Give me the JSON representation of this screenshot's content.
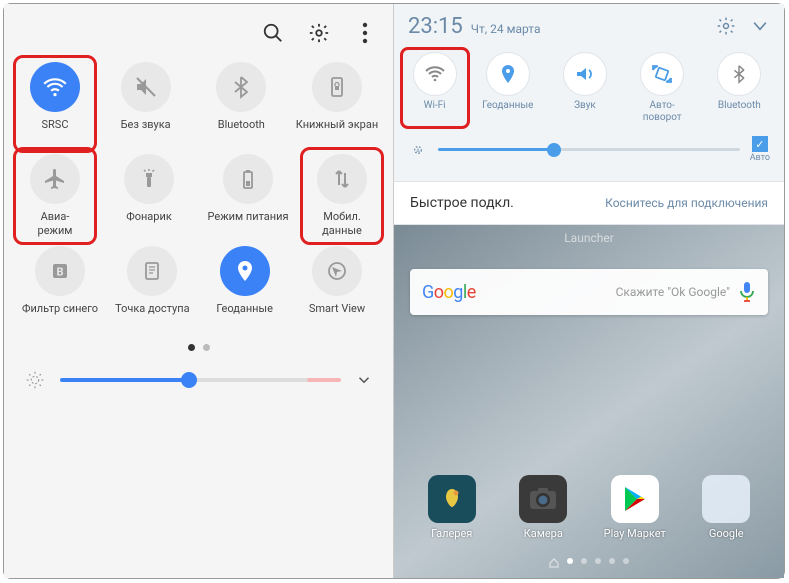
{
  "left_panel": {
    "tiles": [
      {
        "label": "SRSC",
        "active": true,
        "highlight": true,
        "icon": "wifi"
      },
      {
        "label": "Без звука",
        "icon": "mute"
      },
      {
        "label": "Bluetooth",
        "icon": "bluetooth"
      },
      {
        "label": "Книжный экран",
        "icon": "portrait-lock"
      },
      {
        "label": "Авиа-\nрежим",
        "highlight": true,
        "icon": "airplane"
      },
      {
        "label": "Фонарик",
        "icon": "flashlight"
      },
      {
        "label": "Режим питания",
        "icon": "battery"
      },
      {
        "label": "Мобил. данные",
        "highlight": true,
        "icon": "mobile-data"
      },
      {
        "label": "Фильтр синего",
        "icon": "blue-filter"
      },
      {
        "label": "Точка доступа",
        "icon": "hotspot"
      },
      {
        "label": "Геоданные",
        "active": true,
        "icon": "location"
      },
      {
        "label": "Smart View",
        "icon": "smart-view"
      }
    ],
    "brightness": 45
  },
  "right_panel": {
    "time": "23:15",
    "date": "Чт, 24 марта",
    "tiles": [
      {
        "label": "Wi-Fi",
        "highlight": true,
        "icon": "wifi",
        "color": "#888"
      },
      {
        "label": "Геоданные",
        "icon": "location",
        "color": "#4a9de8"
      },
      {
        "label": "Звук",
        "icon": "sound",
        "color": "#4a9de8"
      },
      {
        "label": "Авто-\nповорот",
        "icon": "rotate",
        "color": "#4a9de8"
      },
      {
        "label": "Bluetooth",
        "icon": "bluetooth",
        "color": "#888"
      }
    ],
    "auto_brightness_label": "Авто",
    "brightness": 38,
    "quick_connect_left": "Быстрое подкл.",
    "quick_connect_right": "Коснитесь для подключения",
    "launcher_text": "Launcher",
    "search_hint": "Скажите \"Ok Google\"",
    "apps": [
      {
        "label": "Галерея"
      },
      {
        "label": "Камера"
      },
      {
        "label": "Play Маркет"
      },
      {
        "label": "Google"
      }
    ]
  }
}
